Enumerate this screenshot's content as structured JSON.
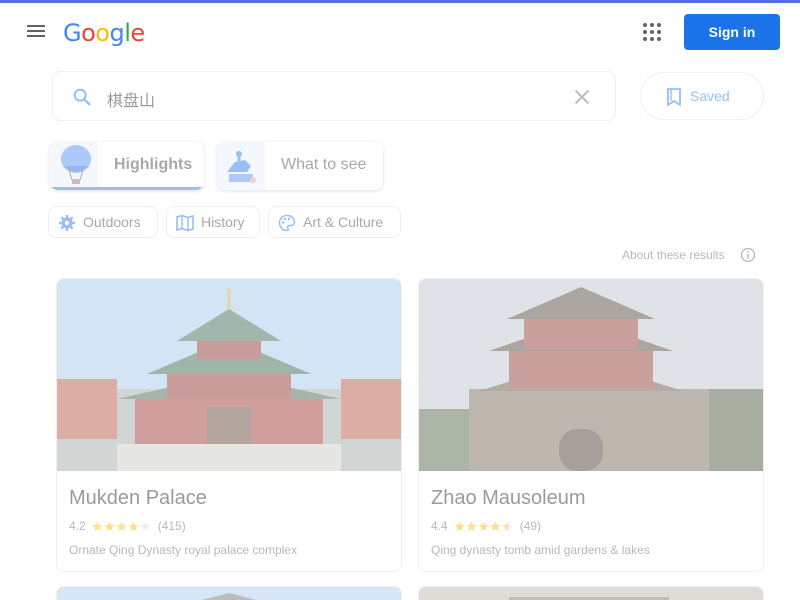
{
  "header": {
    "logo_letters": [
      {
        "ch": "G",
        "color": "#4285f4"
      },
      {
        "ch": "o",
        "color": "#ea4335"
      },
      {
        "ch": "o",
        "color": "#fbbc05"
      },
      {
        "ch": "g",
        "color": "#4285f4"
      },
      {
        "ch": "l",
        "color": "#34a853"
      },
      {
        "ch": "e",
        "color": "#ea4335"
      }
    ],
    "menu_icon": "hamburger-menu-icon",
    "apps_icon": "apps-grid-icon",
    "signin_label": "Sign in"
  },
  "search": {
    "query": "棋盘山",
    "search_icon": "search-icon",
    "clear_icon": "close-icon"
  },
  "saved": {
    "label": "Saved",
    "icon": "bookmark-icon"
  },
  "tabs": [
    {
      "label": "Highlights",
      "active": true
    },
    {
      "label": "What to see",
      "active": false
    }
  ],
  "filters": [
    {
      "label": "Outdoors",
      "icon": "gear-icon"
    },
    {
      "label": "History",
      "icon": "map-icon"
    },
    {
      "label": "Art & Culture",
      "icon": "palette-icon"
    }
  ],
  "about": {
    "label": "About these results",
    "icon": "info-icon"
  },
  "cards": [
    {
      "title": "Mukden Palace",
      "rating": "4.2",
      "stars": 4,
      "reviews": "(415)",
      "description": "Ornate Qing Dynasty royal palace complex"
    },
    {
      "title": "Zhao Mausoleum",
      "rating": "4.4",
      "stars": 4.5,
      "reviews": "(49)",
      "description": "Qing dynasty tomb amid gardens & lakes"
    }
  ],
  "colors": {
    "accent": "#1a73e8",
    "star": "#fbbc04",
    "top_border": "#4f6fdc"
  }
}
